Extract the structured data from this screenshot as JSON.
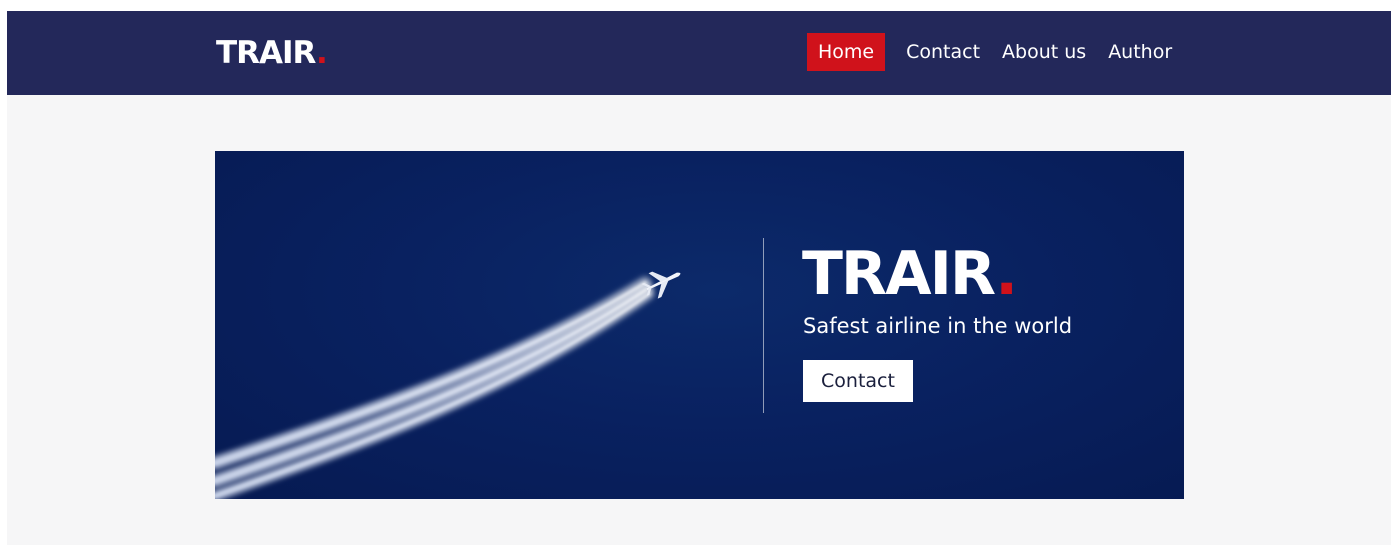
{
  "navbar": {
    "logo": {
      "text": "TRAIR",
      "dot": "."
    },
    "links": [
      {
        "label": "Home",
        "active": true
      },
      {
        "label": "Contact",
        "active": false
      },
      {
        "label": "About us",
        "active": false
      },
      {
        "label": "Author",
        "active": false
      }
    ]
  },
  "hero": {
    "image": {
      "icon": "airplane-icon",
      "subject": "airplane with contrails"
    },
    "brand": {
      "text": "TRAIR",
      "dot": "."
    },
    "tagline": "Safest airline in the world",
    "cta_label": "Contact"
  },
  "colors": {
    "navbar_bg": "#23285a",
    "accent_red": "#d0121b",
    "hero_bg": "#092160",
    "page_bg": "#f6f6f7"
  }
}
